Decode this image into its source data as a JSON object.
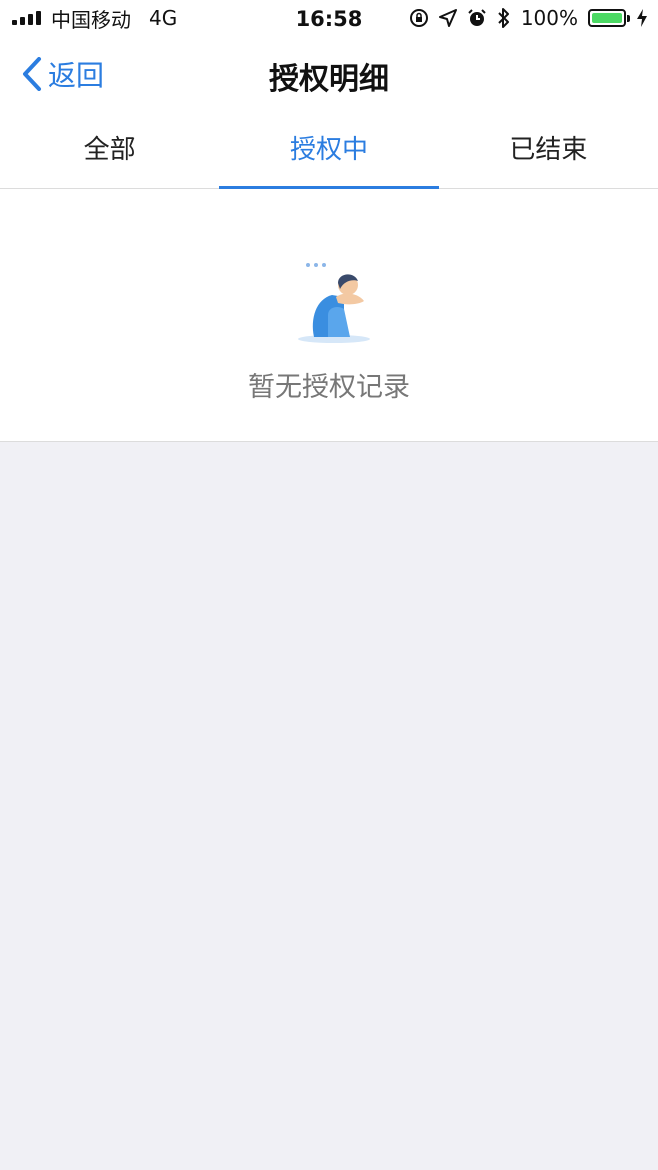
{
  "status_bar": {
    "carrier": "中国移动",
    "network": "4G",
    "time": "16:58",
    "battery": "100%",
    "icons": [
      "signal-icon",
      "orientation-lock-icon",
      "location-icon",
      "alarm-icon",
      "bluetooth-icon",
      "battery-icon",
      "charging-icon"
    ]
  },
  "nav": {
    "back_label": "返回",
    "title": "授权明细"
  },
  "tabs": [
    {
      "label": "全部",
      "active": false
    },
    {
      "label": "授权中",
      "active": true
    },
    {
      "label": "已结束",
      "active": false
    }
  ],
  "empty_state": {
    "message": "暂无授权记录",
    "icon": "sad-person-illustration"
  },
  "colors": {
    "accent": "#2b7de0",
    "background": "#f0f0f5",
    "battery": "#4cd964"
  }
}
